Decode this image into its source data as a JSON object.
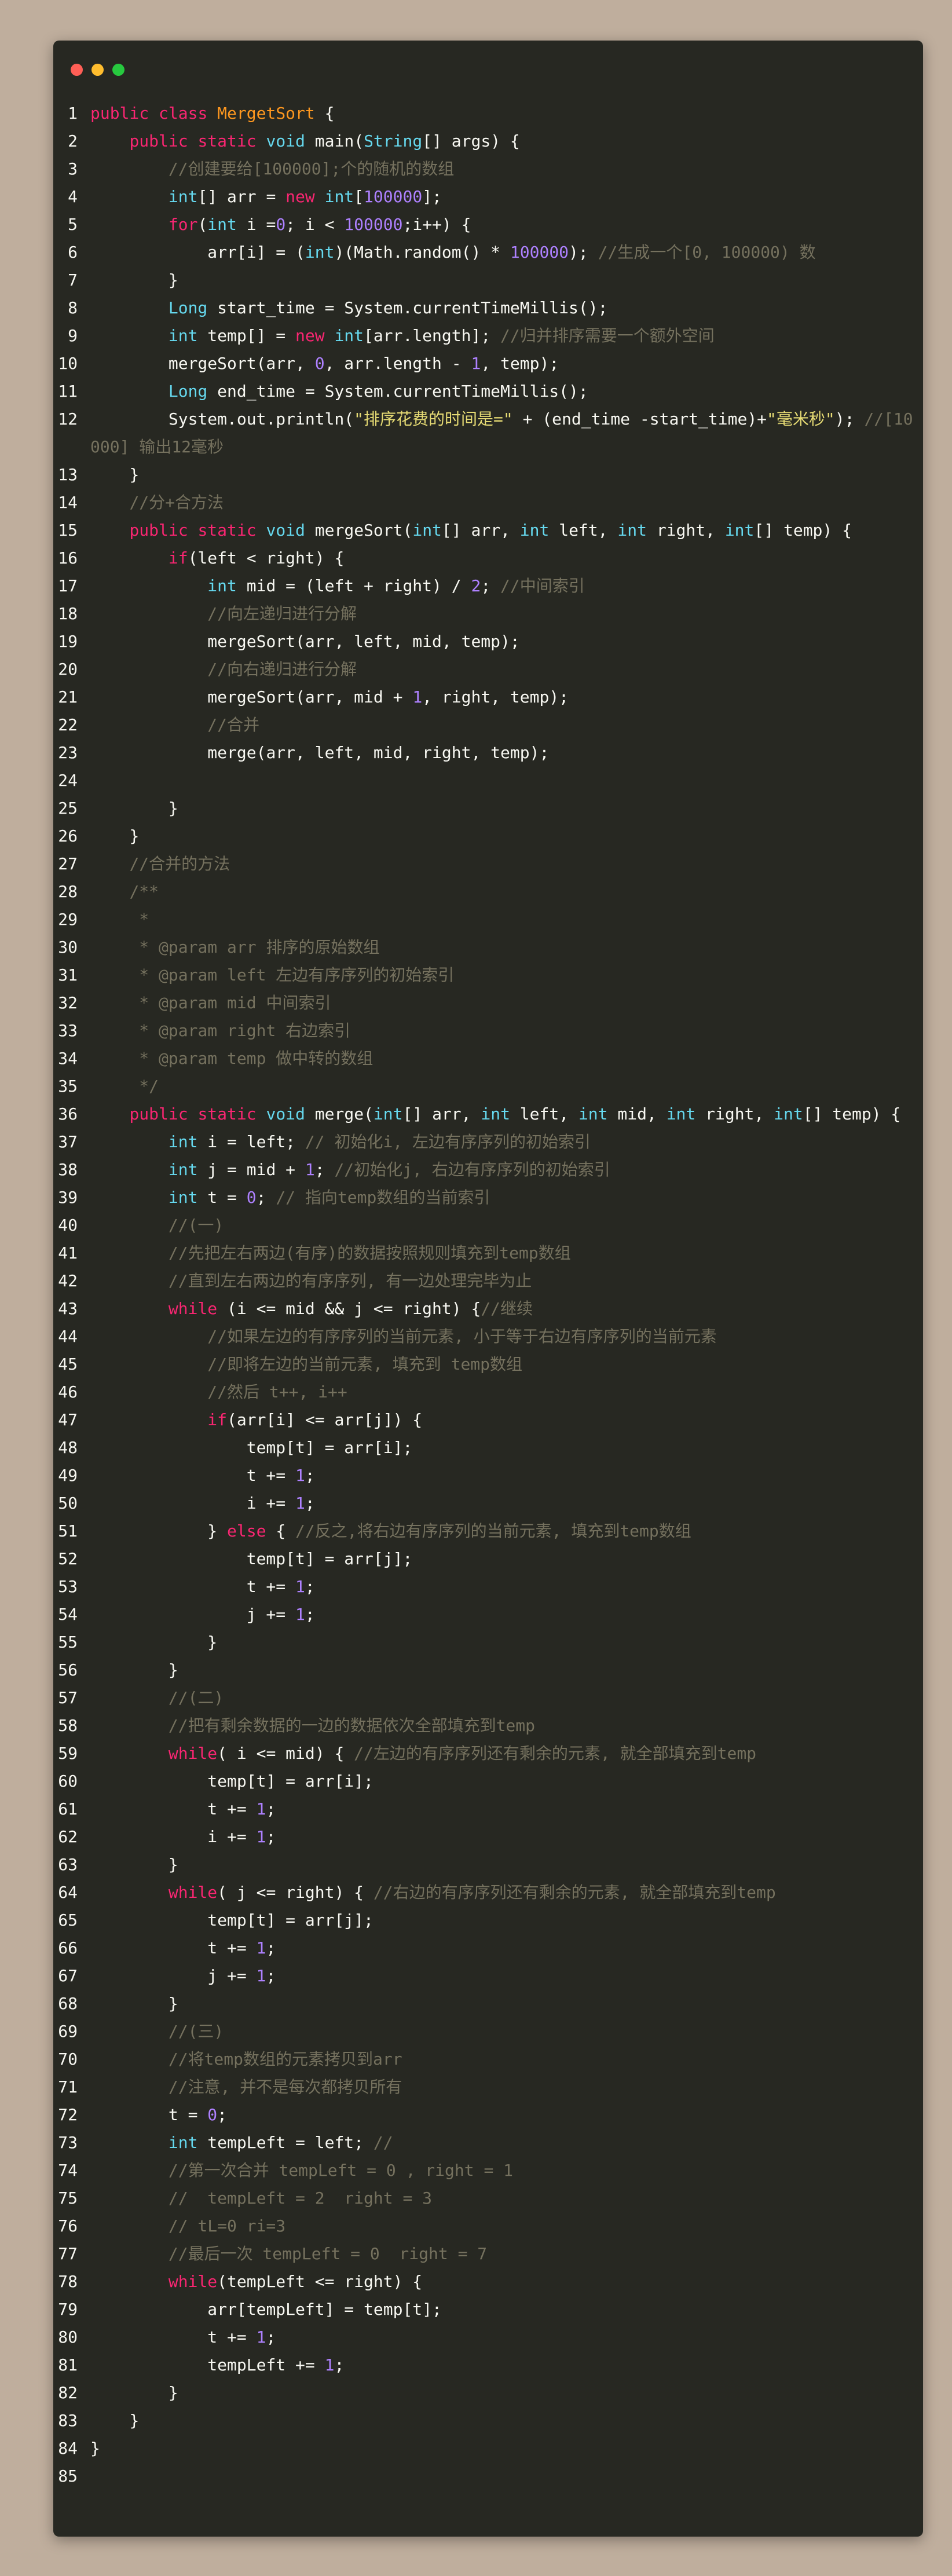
{
  "window": {
    "traffic_lights": [
      {
        "name": "close-button",
        "color": "#ff5f56"
      },
      {
        "name": "minimize-button",
        "color": "#ffbd2e"
      },
      {
        "name": "maximize-button",
        "color": "#27c93f"
      }
    ]
  },
  "theme": {
    "background": "#272822",
    "keyword": "#f92672",
    "type": "#66d9ef",
    "class": "#fd971f",
    "number": "#ae81ff",
    "string": "#e6db74",
    "comment": "#75715e",
    "text": "#f8f8f2"
  },
  "code": [
    [
      [
        "kw",
        "public "
      ],
      [
        "kw",
        "class "
      ],
      [
        "cls",
        "MergetSort"
      ],
      [
        "p",
        " {"
      ]
    ],
    [
      [
        "p",
        "    "
      ],
      [
        "kw",
        "public "
      ],
      [
        "kw",
        "static "
      ],
      [
        "ty",
        "void "
      ],
      [
        "p",
        "main("
      ],
      [
        "ty",
        "String"
      ],
      [
        "p",
        "[] args) {"
      ]
    ],
    [
      [
        "p",
        "        "
      ],
      [
        "com",
        "//创建要给[100000];个的随机的数组"
      ]
    ],
    [
      [
        "p",
        "        "
      ],
      [
        "ty",
        "int"
      ],
      [
        "p",
        "[] arr = "
      ],
      [
        "kw",
        "new "
      ],
      [
        "ty",
        "int"
      ],
      [
        "p",
        "["
      ],
      [
        "num",
        "100000"
      ],
      [
        "p",
        "];"
      ]
    ],
    [
      [
        "p",
        "        "
      ],
      [
        "kw",
        "for"
      ],
      [
        "p",
        "("
      ],
      [
        "ty",
        "int "
      ],
      [
        "p",
        "i ="
      ],
      [
        "num",
        "0"
      ],
      [
        "p",
        "; i < "
      ],
      [
        "num",
        "100000"
      ],
      [
        "p",
        ";i++) {"
      ]
    ],
    [
      [
        "p",
        "            arr[i] = ("
      ],
      [
        "ty",
        "int"
      ],
      [
        "p",
        ")(Math.random() * "
      ],
      [
        "num",
        "100000"
      ],
      [
        "p",
        "); "
      ],
      [
        "com",
        "//生成一个[0, 100000) 数"
      ]
    ],
    [
      [
        "p",
        "        }"
      ]
    ],
    [
      [
        "p",
        "        "
      ],
      [
        "ty",
        "Long "
      ],
      [
        "p",
        "start_time = System.currentTimeMillis();"
      ]
    ],
    [
      [
        "p",
        "        "
      ],
      [
        "ty",
        "int "
      ],
      [
        "p",
        "temp[] = "
      ],
      [
        "kw",
        "new "
      ],
      [
        "ty",
        "int"
      ],
      [
        "p",
        "[arr.length]; "
      ],
      [
        "com",
        "//归并排序需要一个额外空间"
      ]
    ],
    [
      [
        "p",
        "        mergeSort(arr, "
      ],
      [
        "num",
        "0"
      ],
      [
        "p",
        ", arr.length - "
      ],
      [
        "num",
        "1"
      ],
      [
        "p",
        ", temp);"
      ]
    ],
    [
      [
        "p",
        "        "
      ],
      [
        "ty",
        "Long "
      ],
      [
        "p",
        "end_time = System.currentTimeMillis();"
      ]
    ],
    [
      [
        "p",
        "        System.out.println("
      ],
      [
        "str",
        "\"排序花费的时间是=\""
      ],
      [
        "p",
        " + (end_time -start_time)+"
      ],
      [
        "str",
        "\"毫米秒\""
      ],
      [
        "p",
        "); "
      ],
      [
        "com",
        "//[10000] 输出12毫秒"
      ]
    ],
    [
      [
        "p",
        "    }"
      ]
    ],
    [
      [
        "p",
        "    "
      ],
      [
        "com",
        "//分+合方法"
      ]
    ],
    [
      [
        "p",
        "    "
      ],
      [
        "kw",
        "public "
      ],
      [
        "kw",
        "static "
      ],
      [
        "ty",
        "void "
      ],
      [
        "p",
        "mergeSort("
      ],
      [
        "ty",
        "int"
      ],
      [
        "p",
        "[] arr, "
      ],
      [
        "ty",
        "int "
      ],
      [
        "p",
        "left, "
      ],
      [
        "ty",
        "int "
      ],
      [
        "p",
        "right, "
      ],
      [
        "ty",
        "int"
      ],
      [
        "p",
        "[] temp) {"
      ]
    ],
    [
      [
        "p",
        "        "
      ],
      [
        "kw",
        "if"
      ],
      [
        "p",
        "(left < right) {"
      ]
    ],
    [
      [
        "p",
        "            "
      ],
      [
        "ty",
        "int "
      ],
      [
        "p",
        "mid = (left + right) / "
      ],
      [
        "num",
        "2"
      ],
      [
        "p",
        "; "
      ],
      [
        "com",
        "//中间索引"
      ]
    ],
    [
      [
        "p",
        "            "
      ],
      [
        "com",
        "//向左递归进行分解"
      ]
    ],
    [
      [
        "p",
        "            mergeSort(arr, left, mid, temp);"
      ]
    ],
    [
      [
        "p",
        "            "
      ],
      [
        "com",
        "//向右递归进行分解"
      ]
    ],
    [
      [
        "p",
        "            mergeSort(arr, mid + "
      ],
      [
        "num",
        "1"
      ],
      [
        "p",
        ", right, temp);"
      ]
    ],
    [
      [
        "p",
        "            "
      ],
      [
        "com",
        "//合并"
      ]
    ],
    [
      [
        "p",
        "            merge(arr, left, mid, right, temp);"
      ]
    ],
    [
      [
        "p",
        ""
      ]
    ],
    [
      [
        "p",
        "        }"
      ]
    ],
    [
      [
        "p",
        "    }"
      ]
    ],
    [
      [
        "p",
        "    "
      ],
      [
        "com",
        "//合并的方法"
      ]
    ],
    [
      [
        "p",
        "    "
      ],
      [
        "com",
        "/**"
      ]
    ],
    [
      [
        "p",
        "     "
      ],
      [
        "com",
        "*"
      ]
    ],
    [
      [
        "p",
        "     "
      ],
      [
        "com",
        "* @param arr 排序的原始数组"
      ]
    ],
    [
      [
        "p",
        "     "
      ],
      [
        "com",
        "* @param left 左边有序序列的初始索引"
      ]
    ],
    [
      [
        "p",
        "     "
      ],
      [
        "com",
        "* @param mid 中间索引"
      ]
    ],
    [
      [
        "p",
        "     "
      ],
      [
        "com",
        "* @param right 右边索引"
      ]
    ],
    [
      [
        "p",
        "     "
      ],
      [
        "com",
        "* @param temp 做中转的数组"
      ]
    ],
    [
      [
        "p",
        "     "
      ],
      [
        "com",
        "*/"
      ]
    ],
    [
      [
        "p",
        "    "
      ],
      [
        "kw",
        "public "
      ],
      [
        "kw",
        "static "
      ],
      [
        "ty",
        "void "
      ],
      [
        "p",
        "merge("
      ],
      [
        "ty",
        "int"
      ],
      [
        "p",
        "[] arr, "
      ],
      [
        "ty",
        "int "
      ],
      [
        "p",
        "left, "
      ],
      [
        "ty",
        "int "
      ],
      [
        "p",
        "mid, "
      ],
      [
        "ty",
        "int "
      ],
      [
        "p",
        "right, "
      ],
      [
        "ty",
        "int"
      ],
      [
        "p",
        "[] temp) {"
      ]
    ],
    [
      [
        "p",
        "        "
      ],
      [
        "ty",
        "int "
      ],
      [
        "p",
        "i = left; "
      ],
      [
        "com",
        "// 初始化i, 左边有序序列的初始索引"
      ]
    ],
    [
      [
        "p",
        "        "
      ],
      [
        "ty",
        "int "
      ],
      [
        "p",
        "j = mid + "
      ],
      [
        "num",
        "1"
      ],
      [
        "p",
        "; "
      ],
      [
        "com",
        "//初始化j, 右边有序序列的初始索引"
      ]
    ],
    [
      [
        "p",
        "        "
      ],
      [
        "ty",
        "int "
      ],
      [
        "p",
        "t = "
      ],
      [
        "num",
        "0"
      ],
      [
        "p",
        "; "
      ],
      [
        "com",
        "// 指向temp数组的当前索引"
      ]
    ],
    [
      [
        "p",
        "        "
      ],
      [
        "com",
        "//(一)"
      ]
    ],
    [
      [
        "p",
        "        "
      ],
      [
        "com",
        "//先把左右两边(有序)的数据按照规则填充到temp数组"
      ]
    ],
    [
      [
        "p",
        "        "
      ],
      [
        "com",
        "//直到左右两边的有序序列, 有一边处理完毕为止"
      ]
    ],
    [
      [
        "p",
        "        "
      ],
      [
        "kw",
        "while "
      ],
      [
        "p",
        "(i <= mid && j <= right) {"
      ],
      [
        "com",
        "//继续"
      ]
    ],
    [
      [
        "p",
        "            "
      ],
      [
        "com",
        "//如果左边的有序序列的当前元素, 小于等于右边有序序列的当前元素"
      ]
    ],
    [
      [
        "p",
        "            "
      ],
      [
        "com",
        "//即将左边的当前元素, 填充到 temp数组"
      ]
    ],
    [
      [
        "p",
        "            "
      ],
      [
        "com",
        "//然后 t++, i++"
      ]
    ],
    [
      [
        "p",
        "            "
      ],
      [
        "kw",
        "if"
      ],
      [
        "p",
        "(arr[i] <= arr[j]) {"
      ]
    ],
    [
      [
        "p",
        "                temp[t] = arr[i];"
      ]
    ],
    [
      [
        "p",
        "                t += "
      ],
      [
        "num",
        "1"
      ],
      [
        "p",
        ";"
      ]
    ],
    [
      [
        "p",
        "                i += "
      ],
      [
        "num",
        "1"
      ],
      [
        "p",
        ";"
      ]
    ],
    [
      [
        "p",
        "            } "
      ],
      [
        "kw",
        "else "
      ],
      [
        "p",
        "{ "
      ],
      [
        "com",
        "//反之,将右边有序序列的当前元素, 填充到temp数组"
      ]
    ],
    [
      [
        "p",
        "                temp[t] = arr[j];"
      ]
    ],
    [
      [
        "p",
        "                t += "
      ],
      [
        "num",
        "1"
      ],
      [
        "p",
        ";"
      ]
    ],
    [
      [
        "p",
        "                j += "
      ],
      [
        "num",
        "1"
      ],
      [
        "p",
        ";"
      ]
    ],
    [
      [
        "p",
        "            }"
      ]
    ],
    [
      [
        "p",
        "        }"
      ]
    ],
    [
      [
        "p",
        "        "
      ],
      [
        "com",
        "//(二)"
      ]
    ],
    [
      [
        "p",
        "        "
      ],
      [
        "com",
        "//把有剩余数据的一边的数据依次全部填充到temp"
      ]
    ],
    [
      [
        "p",
        "        "
      ],
      [
        "kw",
        "while"
      ],
      [
        "p",
        "( i <= mid) { "
      ],
      [
        "com",
        "//左边的有序序列还有剩余的元素, 就全部填充到temp"
      ]
    ],
    [
      [
        "p",
        "            temp[t] = arr[i];"
      ]
    ],
    [
      [
        "p",
        "            t += "
      ],
      [
        "num",
        "1"
      ],
      [
        "p",
        ";"
      ]
    ],
    [
      [
        "p",
        "            i += "
      ],
      [
        "num",
        "1"
      ],
      [
        "p",
        ";"
      ]
    ],
    [
      [
        "p",
        "        }"
      ]
    ],
    [
      [
        "p",
        "        "
      ],
      [
        "kw",
        "while"
      ],
      [
        "p",
        "( j <= right) { "
      ],
      [
        "com",
        "//右边的有序序列还有剩余的元素, 就全部填充到temp"
      ]
    ],
    [
      [
        "p",
        "            temp[t] = arr[j];"
      ]
    ],
    [
      [
        "p",
        "            t += "
      ],
      [
        "num",
        "1"
      ],
      [
        "p",
        ";"
      ]
    ],
    [
      [
        "p",
        "            j += "
      ],
      [
        "num",
        "1"
      ],
      [
        "p",
        ";"
      ]
    ],
    [
      [
        "p",
        "        }"
      ]
    ],
    [
      [
        "p",
        "        "
      ],
      [
        "com",
        "//(三)"
      ]
    ],
    [
      [
        "p",
        "        "
      ],
      [
        "com",
        "//将temp数组的元素拷贝到arr"
      ]
    ],
    [
      [
        "p",
        "        "
      ],
      [
        "com",
        "//注意, 并不是每次都拷贝所有"
      ]
    ],
    [
      [
        "p",
        "        t = "
      ],
      [
        "num",
        "0"
      ],
      [
        "p",
        ";"
      ]
    ],
    [
      [
        "p",
        "        "
      ],
      [
        "ty",
        "int "
      ],
      [
        "p",
        "tempLeft = left; "
      ],
      [
        "com",
        "//"
      ]
    ],
    [
      [
        "p",
        "        "
      ],
      [
        "com",
        "//第一次合并 tempLeft = 0 , right = 1"
      ]
    ],
    [
      [
        "p",
        "        "
      ],
      [
        "com",
        "//  tempLeft = 2  right = 3"
      ]
    ],
    [
      [
        "p",
        "        "
      ],
      [
        "com",
        "// tL=0 ri=3"
      ]
    ],
    [
      [
        "p",
        "        "
      ],
      [
        "com",
        "//最后一次 tempLeft = 0  right = 7"
      ]
    ],
    [
      [
        "p",
        "        "
      ],
      [
        "kw",
        "while"
      ],
      [
        "p",
        "(tempLeft <= right) {"
      ]
    ],
    [
      [
        "p",
        "            arr[tempLeft] = temp[t];"
      ]
    ],
    [
      [
        "p",
        "            t += "
      ],
      [
        "num",
        "1"
      ],
      [
        "p",
        ";"
      ]
    ],
    [
      [
        "p",
        "            tempLeft += "
      ],
      [
        "num",
        "1"
      ],
      [
        "p",
        ";"
      ]
    ],
    [
      [
        "p",
        "        }"
      ]
    ],
    [
      [
        "p",
        "    }"
      ]
    ],
    [
      [
        "p",
        "}"
      ]
    ],
    [
      [
        "p",
        ""
      ]
    ]
  ]
}
